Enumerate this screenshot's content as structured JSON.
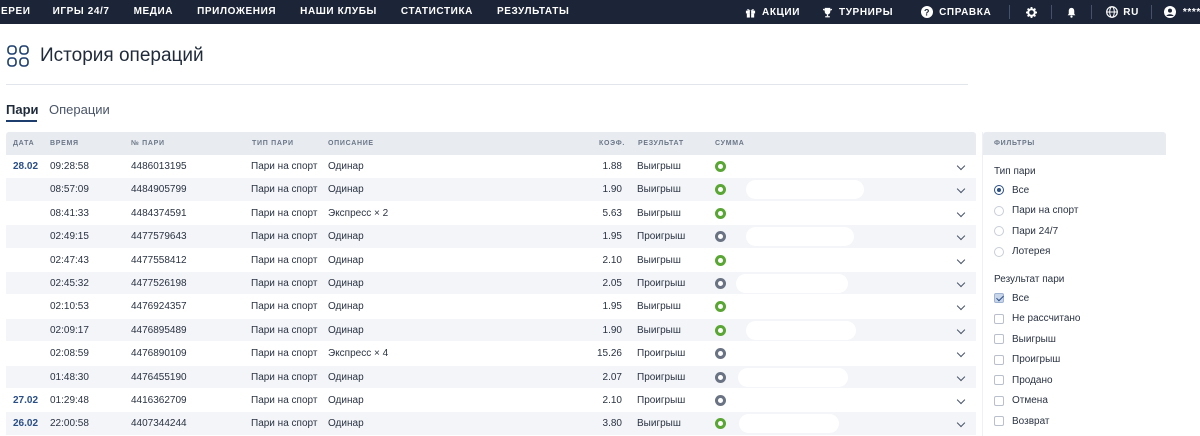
{
  "nav": {
    "items": [
      "ЕРЕИ",
      "ИГРЫ 24/7",
      "МЕДИА",
      "ПРИЛОЖЕНИЯ",
      "НАШИ КЛУБЫ",
      "СТАТИСТИКА",
      "РЕЗУЛЬТАТЫ"
    ],
    "promos": "АКЦИИ",
    "tournaments": "ТУРНИРЫ",
    "help": "СПРАВКА",
    "language": "RU",
    "balance_mask": "****",
    "icons": [
      "gift-icon",
      "trophy-icon",
      "help-icon",
      "gear-icon",
      "bell-icon",
      "globe-icon",
      "user-icon",
      "eye-icon"
    ],
    "background": "#1c2538"
  },
  "page": {
    "title": "История операций",
    "icon": "grid-icon"
  },
  "tabs": [
    {
      "label": "Пари",
      "active": true
    },
    {
      "label": "Операции",
      "active": false
    }
  ],
  "table": {
    "columns": {
      "date": "ДАТА",
      "time": "ВРЕМЯ",
      "bet_no": "№ ПАРИ",
      "bet_type": "ТИП ПАРИ",
      "description": "ОПИСАНИЕ",
      "coef": "КОЭФ.",
      "result": "РЕЗУЛЬТАТ",
      "sum": "СУММА"
    },
    "rows": [
      {
        "date": "28.02",
        "time": "09:28:58",
        "bet_no": "4486013195",
        "type": "Пари на спорт",
        "desc": "Одинар",
        "coef": "1.88",
        "result": "Выигрыш",
        "win": true
      },
      {
        "date": "",
        "time": "08:57:09",
        "bet_no": "4484905799",
        "type": "Пари на спорт",
        "desc": "Одинар",
        "coef": "1.90",
        "result": "Выигрыш",
        "win": true
      },
      {
        "date": "",
        "time": "08:41:33",
        "bet_no": "4484374591",
        "type": "Пари на спорт",
        "desc": "Экспресс × 2",
        "coef": "5.63",
        "result": "Выигрыш",
        "win": true
      },
      {
        "date": "",
        "time": "02:49:15",
        "bet_no": "4477579643",
        "type": "Пари на спорт",
        "desc": "Одинар",
        "coef": "1.95",
        "result": "Проигрыш",
        "win": false
      },
      {
        "date": "",
        "time": "02:47:43",
        "bet_no": "4477558412",
        "type": "Пари на спорт",
        "desc": "Одинар",
        "coef": "2.10",
        "result": "Выигрыш",
        "win": true
      },
      {
        "date": "",
        "time": "02:45:32",
        "bet_no": "4477526198",
        "type": "Пари на спорт",
        "desc": "Одинар",
        "coef": "2.05",
        "result": "Проигрыш",
        "win": false
      },
      {
        "date": "",
        "time": "02:10:53",
        "bet_no": "4476924357",
        "type": "Пари на спорт",
        "desc": "Одинар",
        "coef": "1.95",
        "result": "Выигрыш",
        "win": true
      },
      {
        "date": "",
        "time": "02:09:17",
        "bet_no": "4476895489",
        "type": "Пари на спорт",
        "desc": "Одинар",
        "coef": "1.90",
        "result": "Выигрыш",
        "win": true
      },
      {
        "date": "",
        "time": "02:08:59",
        "bet_no": "4476890109",
        "type": "Пари на спорт",
        "desc": "Экспресс × 4",
        "coef": "15.26",
        "result": "Проигрыш",
        "win": false
      },
      {
        "date": "",
        "time": "01:48:30",
        "bet_no": "4476455190",
        "type": "Пари на спорт",
        "desc": "Одинар",
        "coef": "2.07",
        "result": "Проигрыш",
        "win": false
      },
      {
        "date": "27.02",
        "time": "01:29:48",
        "bet_no": "4416362709",
        "type": "Пари на спорт",
        "desc": "Одинар",
        "coef": "2.10",
        "result": "Проигрыш",
        "win": false
      },
      {
        "date": "26.02",
        "time": "22:00:58",
        "bet_no": "4407344244",
        "type": "Пари на спорт",
        "desc": "Одинар",
        "coef": "3.80",
        "result": "Выигрыш",
        "win": true
      }
    ],
    "colors": {
      "win": "#5aa634",
      "lose": "#6a7383",
      "date": "#2a4e86"
    }
  },
  "filters": {
    "header": "ФИЛЬТРЫ",
    "bet_type": {
      "title": "Тип пари",
      "options": [
        {
          "label": "Все",
          "checked": true
        },
        {
          "label": "Пари на спорт",
          "checked": false
        },
        {
          "label": "Пари 24/7",
          "checked": false
        },
        {
          "label": "Лотерея",
          "checked": false
        }
      ]
    },
    "bet_result": {
      "title": "Результат пари",
      "options": [
        {
          "label": "Все",
          "checked": true
        },
        {
          "label": "Не рассчитано",
          "checked": false
        },
        {
          "label": "Выигрыш",
          "checked": false
        },
        {
          "label": "Проигрыш",
          "checked": false
        },
        {
          "label": "Продано",
          "checked": false
        },
        {
          "label": "Отмена",
          "checked": false
        },
        {
          "label": "Возврат",
          "checked": false
        }
      ]
    }
  }
}
